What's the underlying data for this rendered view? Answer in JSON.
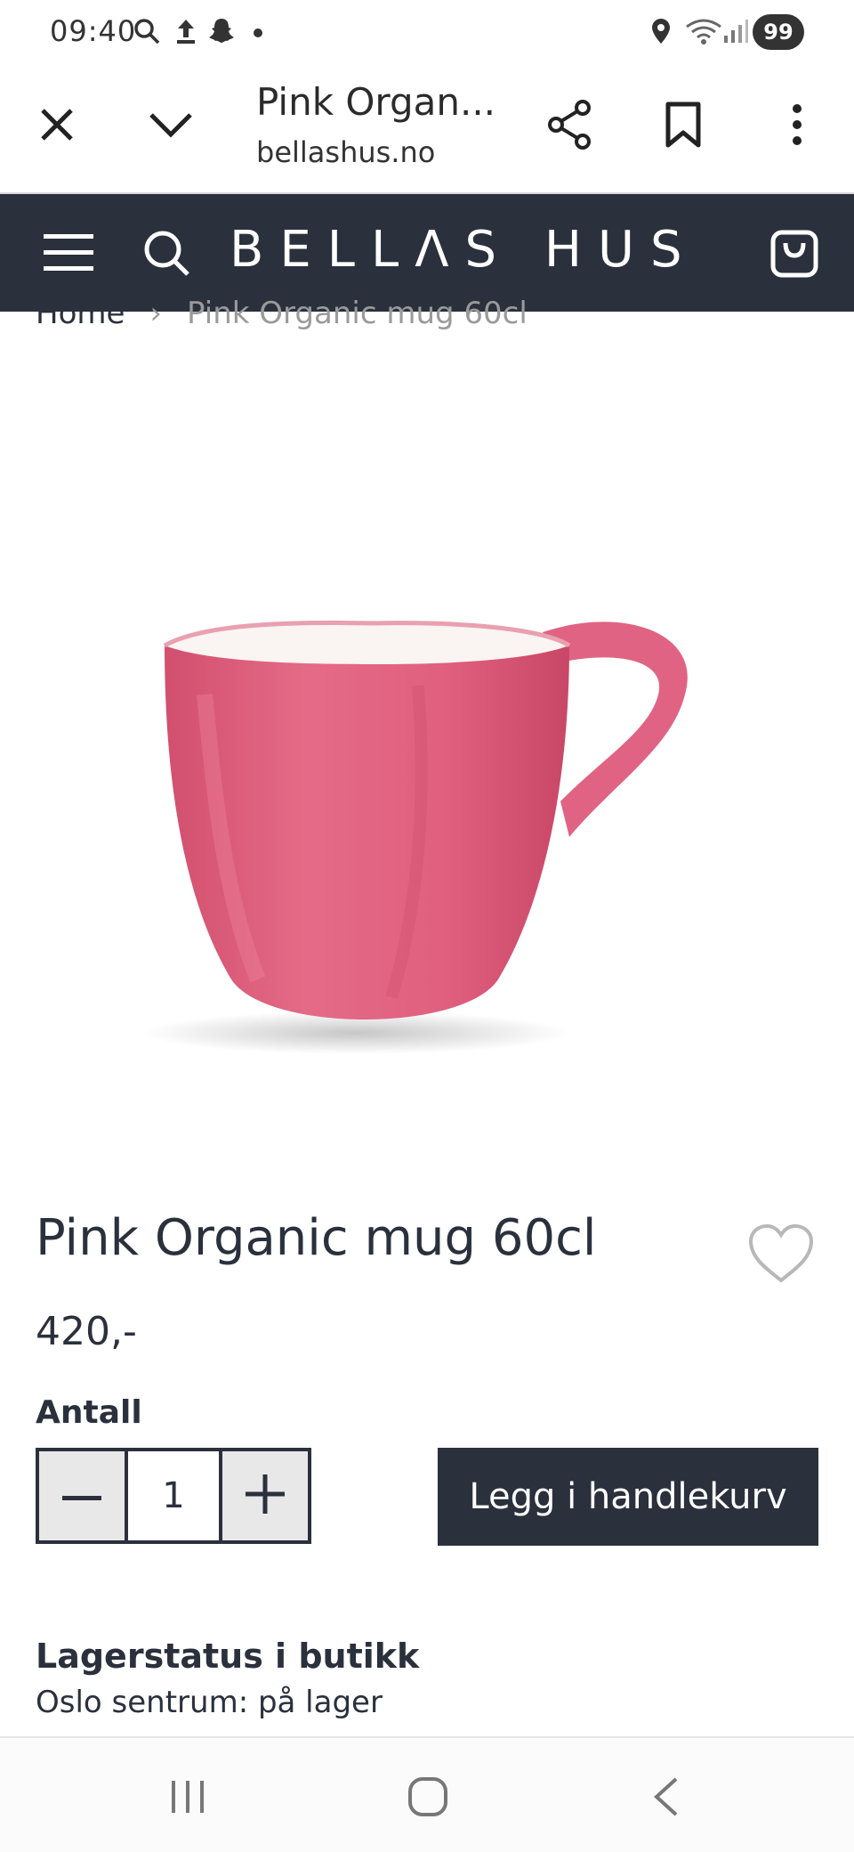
{
  "status_bar": {
    "time": "09:40",
    "battery": "99",
    "icons": [
      "search-icon",
      "upload-icon",
      "snapchat-icon",
      "dot-icon",
      "location-icon",
      "wifi-icon",
      "signal-icon"
    ]
  },
  "browser": {
    "title": "Pink Organ...",
    "domain": "bellashus.no",
    "icons": [
      "close-icon",
      "chevron-down-icon",
      "share-icon",
      "bookmark-icon",
      "more-icon"
    ]
  },
  "site_header": {
    "logo": "BELLΛS HUS",
    "icons": [
      "menu-icon",
      "search-icon",
      "cart-icon"
    ]
  },
  "breadcrumb": {
    "home": "Home",
    "separator": "›",
    "current": "Pink Organic mug 60cl"
  },
  "product": {
    "title": "Pink Organic mug 60cl",
    "price": "420,-",
    "quantity_label": "Antall",
    "quantity": "1",
    "add_to_cart": "Legg i handlekurv",
    "image_color": "#e0607e"
  },
  "stock": {
    "heading": "Lagerstatus i butikk",
    "line": "Oslo sentrum: på lager"
  },
  "colors": {
    "header_bg": "#2a303c",
    "button_bg": "#2a303c",
    "stepper_btn_bg": "#e8e8e8"
  }
}
